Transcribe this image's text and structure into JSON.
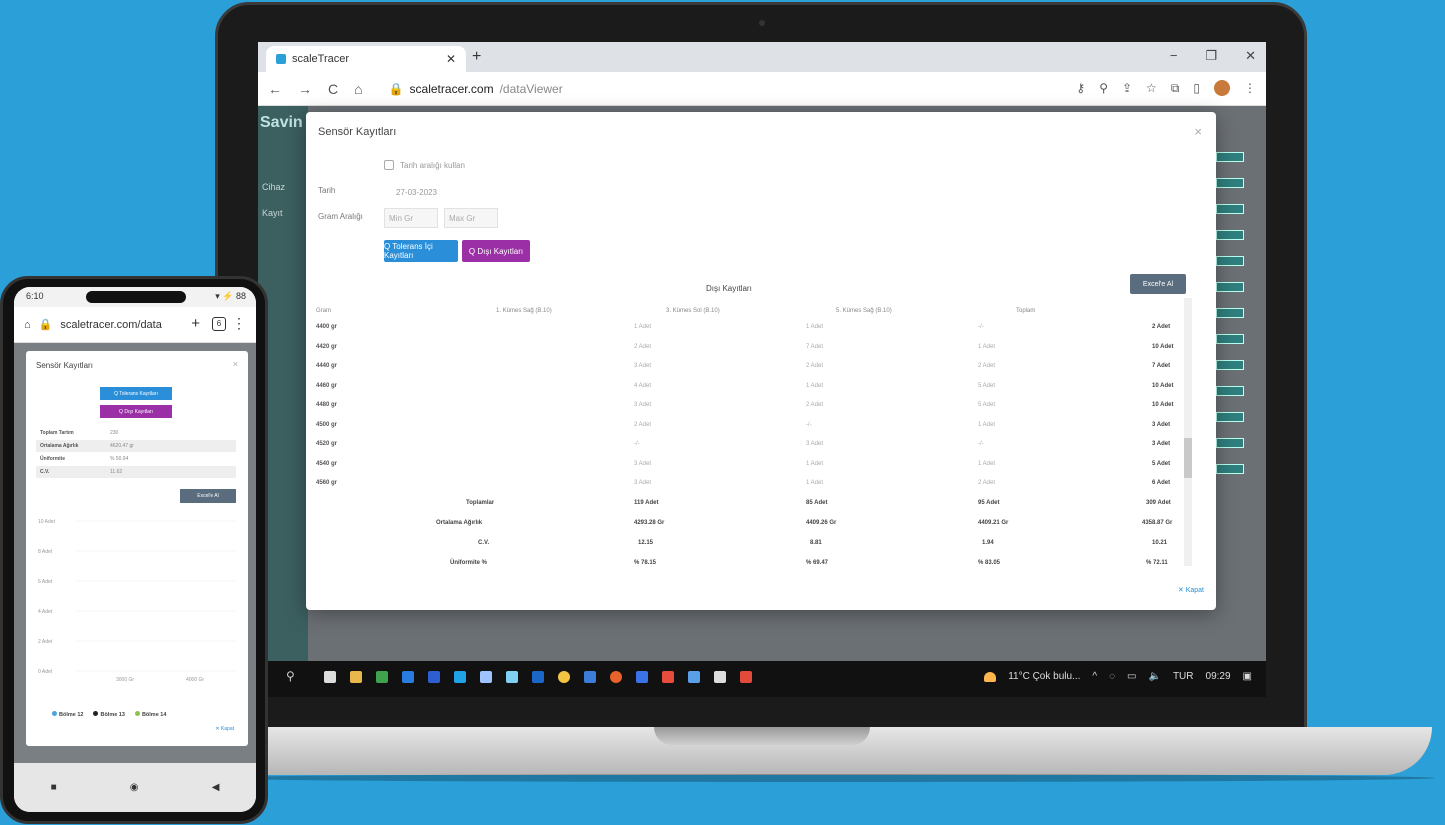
{
  "laptop": {
    "browser": {
      "tab_title": "scaleTracer",
      "tab_close": "✕",
      "new_tab": "+",
      "url_host": "scaletracer.com",
      "url_path": "/dataViewer",
      "nav_back": "←",
      "nav_forward": "→",
      "nav_reload": "C",
      "nav_home": "⌂",
      "win_minimize": "−",
      "win_restore": "❐",
      "win_close": "✕"
    },
    "app": {
      "logo": "Savin",
      "sidebar_items": [
        "Cihaz",
        "Kayıt"
      ]
    },
    "modal": {
      "title": "Sensör Kayıtları",
      "close": "×",
      "checkbox_label": "Tarih aralığı kullan",
      "date_label": "Tarih",
      "date_value": "27-03-2023",
      "range_label": "Gram Aralığı",
      "min_placeholder": "Min Gr",
      "max_placeholder": "Max Gr",
      "btn_inside": "Q Tolerans İçi Kayıtları",
      "btn_outside": "Q Dışı Kayıtları",
      "table_title": "Dışı Kayıtları",
      "btn_excel": "Excel'e Al",
      "columns": [
        "Gram",
        "1. Kümes Sağ (B.10)",
        "3. Kümes Sol (B.10)",
        "5. Kümes Sağ (B.10)",
        "Toplam"
      ],
      "rows": [
        {
          "g": "4400 gr",
          "c1": "1 Adet",
          "c2": "1 Adet",
          "c3": "-/-",
          "tot": "2 Adet"
        },
        {
          "g": "4420 gr",
          "c1": "2 Adet",
          "c2": "7 Adet",
          "c3": "1 Adet",
          "tot": "10 Adet"
        },
        {
          "g": "4440 gr",
          "c1": "3 Adet",
          "c2": "2 Adet",
          "c3": "2 Adet",
          "tot": "7 Adet"
        },
        {
          "g": "4460 gr",
          "c1": "4 Adet",
          "c2": "1 Adet",
          "c3": "5 Adet",
          "tot": "10 Adet"
        },
        {
          "g": "4480 gr",
          "c1": "3 Adet",
          "c2": "2 Adet",
          "c3": "5 Adet",
          "tot": "10 Adet"
        },
        {
          "g": "4500 gr",
          "c1": "2 Adet",
          "c2": "-/-",
          "c3": "1 Adet",
          "tot": "3 Adet"
        },
        {
          "g": "4520 gr",
          "c1": "-/-",
          "c2": "3 Adet",
          "c3": "-/-",
          "tot": "3 Adet"
        },
        {
          "g": "4540 gr",
          "c1": "3 Adet",
          "c2": "1 Adet",
          "c3": "1 Adet",
          "tot": "5 Adet"
        },
        {
          "g": "4560 gr",
          "c1": "3 Adet",
          "c2": "1 Adet",
          "c3": "2 Adet",
          "tot": "6 Adet"
        }
      ],
      "summary": [
        {
          "k": "Toplamlar",
          "c1": "119 Adet",
          "c2": "85 Adet",
          "c3": "95 Adet",
          "tot": "309 Adet"
        },
        {
          "k": "Ortalama Ağırlık",
          "c1": "4293.28 Gr",
          "c2": "4409.26 Gr",
          "c3": "4409.21 Gr",
          "tot": "4358.87 Gr"
        },
        {
          "k": "C.V.",
          "c1": "12.15",
          "c2": "8.81",
          "c3": "1.94",
          "tot": "10.21"
        },
        {
          "k": "Üniformite %",
          "c1": "% 78.15",
          "c2": "% 69.47",
          "c3": "% 83.05",
          "tot": "% 72.11"
        }
      ],
      "close_link": "✕ Kapat"
    },
    "taskbar": {
      "search_icon": "⚲",
      "weather": "11°C Çok bulu...",
      "lang": "TUR",
      "time": "09:29"
    }
  },
  "phone": {
    "status_time": "6:10",
    "status_right": "▾ ⚡ 88",
    "url": "scaletracer.com/data",
    "tab_count": "6",
    "plus": "+",
    "menu": "⋮",
    "modal_title": "Sensör Kayıtları",
    "close": "×",
    "btn_inside": "Q Tolerans Kayıtları",
    "btn_outside": "Q Dışı Kayıtları",
    "stats": [
      {
        "k": "Toplam Tartım",
        "v": "230"
      },
      {
        "k": "Ortalama Ağırlık",
        "v": "4620.47 gr"
      },
      {
        "k": "Üniformite",
        "v": "% 50.94"
      },
      {
        "k": "C.V.",
        "v": "11.62"
      }
    ],
    "btn_excel": "Excel'e Al",
    "chart_data": {
      "type": "bar",
      "y_ticks": [
        "10 Adet",
        "8 Adet",
        "6 Adet",
        "4 Adet",
        "2 Adet",
        "0 Adet"
      ],
      "x_ticks": [
        "3000 Gr",
        "4000 Gr"
      ],
      "ylim": [
        0,
        10
      ],
      "series": [
        {
          "name": "Bölme 12",
          "color": "#4aa3df"
        },
        {
          "name": "Bölme 13",
          "color": "#222222"
        },
        {
          "name": "Bölme 14",
          "color": "#8bc34a"
        }
      ]
    },
    "close_link": "✕ Kapat",
    "nav": [
      "■",
      "◉",
      "◀"
    ]
  }
}
